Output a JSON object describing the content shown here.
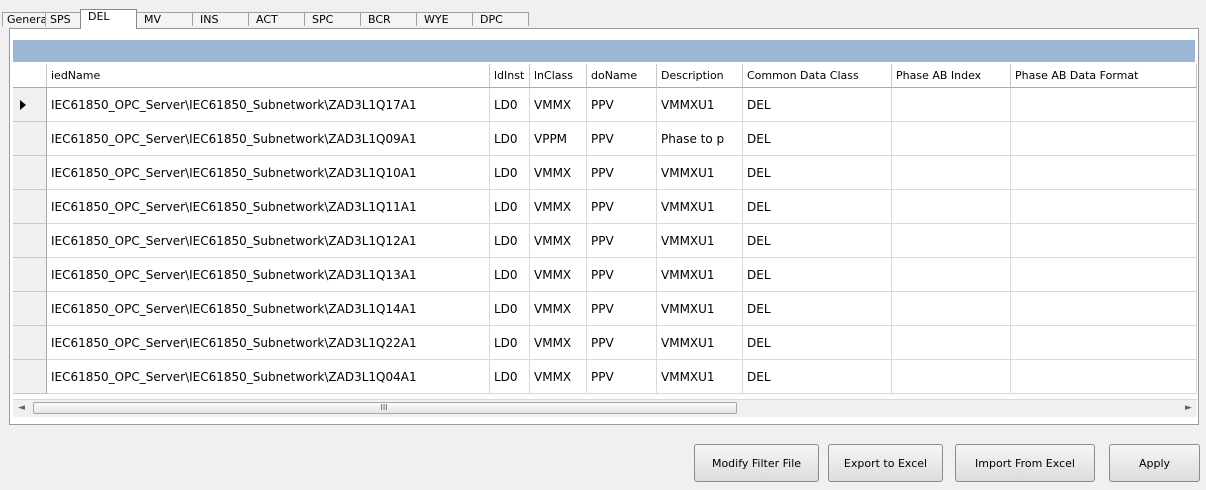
{
  "tabs": [
    {
      "label": "General"
    },
    {
      "label": "SPS"
    },
    {
      "label": "DEL"
    },
    {
      "label": "MV"
    },
    {
      "label": "INS"
    },
    {
      "label": "ACT"
    },
    {
      "label": "SPC"
    },
    {
      "label": "BCR"
    },
    {
      "label": "WYE"
    },
    {
      "label": "DPC"
    }
  ],
  "active_tab": "DEL",
  "grid": {
    "columns": [
      "iedName",
      "ldInst",
      "lnClass",
      "doName",
      "Description",
      "Common Data Class",
      "Phase AB Index",
      "Phase AB Data Format"
    ],
    "rows": [
      {
        "iedName": "IEC61850_OPC_Server\\IEC61850_Subnetwork\\ZAD3L1Q17A1",
        "ldInst": "LD0",
        "lnClass": "VMMX",
        "doName": "PPV",
        "description": "VMMXU1",
        "cdc": "DEL",
        "phAB_index": "",
        "phAB_format": "",
        "current": true
      },
      {
        "iedName": "IEC61850_OPC_Server\\IEC61850_Subnetwork\\ZAD3L1Q09A1",
        "ldInst": "LD0",
        "lnClass": "VPPM",
        "doName": "PPV",
        "description": "Phase to p",
        "cdc": "DEL",
        "phAB_index": "",
        "phAB_format": "",
        "current": false
      },
      {
        "iedName": "IEC61850_OPC_Server\\IEC61850_Subnetwork\\ZAD3L1Q10A1",
        "ldInst": "LD0",
        "lnClass": "VMMX",
        "doName": "PPV",
        "description": "VMMXU1",
        "cdc": "DEL",
        "phAB_index": "",
        "phAB_format": "",
        "current": false
      },
      {
        "iedName": "IEC61850_OPC_Server\\IEC61850_Subnetwork\\ZAD3L1Q11A1",
        "ldInst": "LD0",
        "lnClass": "VMMX",
        "doName": "PPV",
        "description": "VMMXU1",
        "cdc": "DEL",
        "phAB_index": "",
        "phAB_format": "",
        "current": false
      },
      {
        "iedName": "IEC61850_OPC_Server\\IEC61850_Subnetwork\\ZAD3L1Q12A1",
        "ldInst": "LD0",
        "lnClass": "VMMX",
        "doName": "PPV",
        "description": "VMMXU1",
        "cdc": "DEL",
        "phAB_index": "",
        "phAB_format": "",
        "current": false
      },
      {
        "iedName": "IEC61850_OPC_Server\\IEC61850_Subnetwork\\ZAD3L1Q13A1",
        "ldInst": "LD0",
        "lnClass": "VMMX",
        "doName": "PPV",
        "description": "VMMXU1",
        "cdc": "DEL",
        "phAB_index": "",
        "phAB_format": "",
        "current": false
      },
      {
        "iedName": "IEC61850_OPC_Server\\IEC61850_Subnetwork\\ZAD3L1Q14A1",
        "ldInst": "LD0",
        "lnClass": "VMMX",
        "doName": "PPV",
        "description": "VMMXU1",
        "cdc": "DEL",
        "phAB_index": "",
        "phAB_format": "",
        "current": false
      },
      {
        "iedName": "IEC61850_OPC_Server\\IEC61850_Subnetwork\\ZAD3L1Q22A1",
        "ldInst": "LD0",
        "lnClass": "VMMX",
        "doName": "PPV",
        "description": "VMMXU1",
        "cdc": "DEL",
        "phAB_index": "",
        "phAB_format": "",
        "current": false
      },
      {
        "iedName": "IEC61850_OPC_Server\\IEC61850_Subnetwork\\ZAD3L1Q04A1",
        "ldInst": "LD0",
        "lnClass": "VMMX",
        "doName": "PPV",
        "description": "VMMXU1",
        "cdc": "DEL",
        "phAB_index": "",
        "phAB_format": "",
        "current": false
      }
    ]
  },
  "scrollbar": {
    "left_arrow": "◄",
    "right_arrow": "►",
    "grip": "III"
  },
  "buttons": {
    "modify_filter": "Modify Filter File",
    "export_excel": "Export to Excel",
    "import_excel": "Import From Excel",
    "apply": "Apply"
  },
  "colors": {
    "caption_bar": "#9cb6d6",
    "window_bg": "#f0f0f0"
  }
}
